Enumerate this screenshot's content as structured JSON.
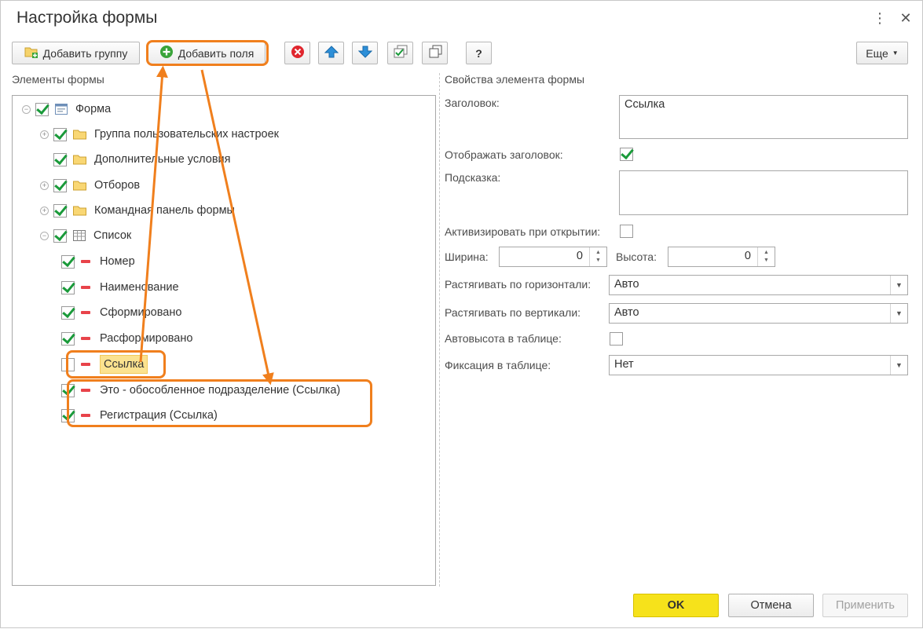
{
  "window": {
    "title": "Настройка формы"
  },
  "toolbar": {
    "add_group": "Добавить группу",
    "add_fields": "Добавить поля",
    "help": "?",
    "more": "Еще"
  },
  "left": {
    "title": "Элементы формы",
    "tree": [
      {
        "label": "Форма",
        "checked": true,
        "icon": "form-icon",
        "expander": "minus"
      },
      {
        "label": "Группа пользовательских настроек",
        "checked": true,
        "icon": "folder-icon",
        "expander": "plus"
      },
      {
        "label": "Дополнительные условия",
        "checked": true,
        "icon": "folder-icon",
        "expander": "none"
      },
      {
        "label": "Отборов",
        "checked": true,
        "icon": "folder-icon",
        "expander": "plus"
      },
      {
        "label": "Командная панель формы",
        "checked": true,
        "icon": "folder-icon",
        "expander": "plus"
      },
      {
        "label": "Список",
        "checked": true,
        "icon": "table-icon",
        "expander": "minus"
      },
      {
        "label": "Номер",
        "checked": true,
        "icon": "field-icon"
      },
      {
        "label": "Наименование",
        "checked": true,
        "icon": "field-icon"
      },
      {
        "label": "Сформировано",
        "checked": true,
        "icon": "field-icon"
      },
      {
        "label": "Расформировано",
        "checked": true,
        "icon": "field-icon"
      },
      {
        "label": "Ссылка",
        "checked": false,
        "icon": "field-icon",
        "selected": true
      },
      {
        "label": "Это - обособленное подразделение (Ссылка)",
        "checked": true,
        "icon": "field-icon"
      },
      {
        "label": "Регистрация (Ссылка)",
        "checked": true,
        "icon": "field-icon"
      }
    ]
  },
  "right": {
    "title": "Свойства элемента формы",
    "caption_label": "Заголовок:",
    "caption_value": "Ссылка",
    "show_caption_label": "Отображать заголовок:",
    "show_caption": true,
    "tooltip_label": "Подсказка:",
    "tooltip_value": "",
    "activate_label": "Активизировать при открытии:",
    "activate": false,
    "width_label": "Ширина:",
    "width_value": "0",
    "height_label": "Высота:",
    "height_value": "0",
    "stretch_h_label": "Растягивать по горизонтали:",
    "stretch_h_value": "Авто",
    "stretch_v_label": "Растягивать по вертикали:",
    "stretch_v_value": "Авто",
    "autoheight_label": "Автовысота в таблице:",
    "autoheight": false,
    "fix_label": "Фиксация в таблице:",
    "fix_value": "Нет"
  },
  "footer": {
    "ok": "OK",
    "cancel": "Отмена",
    "apply": "Применить"
  },
  "colors": {
    "accent": "#f6e21b",
    "annotation": "#f07f1d",
    "check": "#1a9a3a"
  }
}
